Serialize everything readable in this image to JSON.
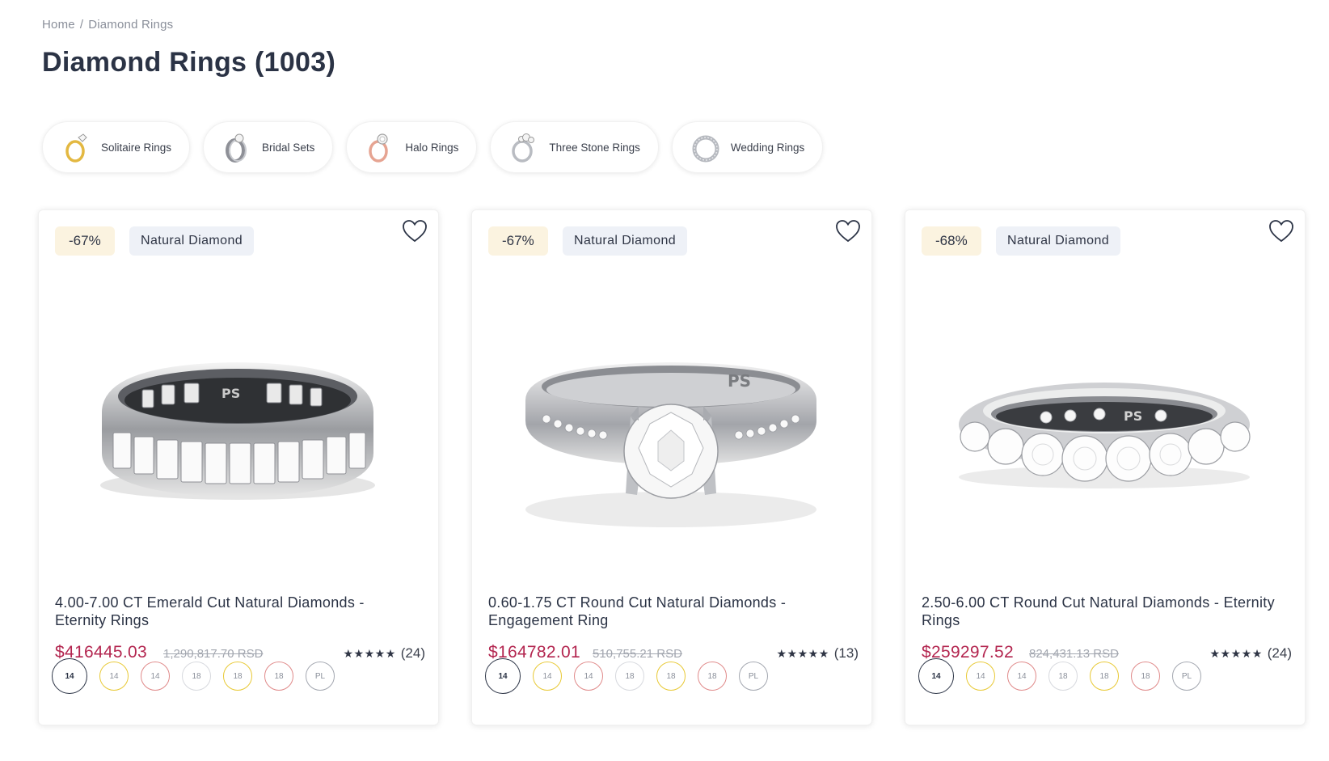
{
  "breadcrumb": {
    "home": "Home",
    "separator": "/",
    "current": "Diamond Rings"
  },
  "page_title": "Diamond Rings (1003)",
  "categories": [
    {
      "label": "Solitaire Rings",
      "icon": "solitaire-ring-icon"
    },
    {
      "label": "Bridal Sets",
      "icon": "bridal-set-icon"
    },
    {
      "label": "Halo Rings",
      "icon": "halo-ring-icon"
    },
    {
      "label": "Three Stone Rings",
      "icon": "three-stone-ring-icon"
    },
    {
      "label": "Wedding Rings",
      "icon": "wedding-ring-icon"
    }
  ],
  "products": [
    {
      "discount": "-67%",
      "type": "Natural Diamond",
      "title": "4.00-7.00 CT Emerald Cut Natural Diamonds - Eternity Rings",
      "price": "$416445.03",
      "old_price": "1,290,817.70 RSD",
      "stars": "★★★★★",
      "reviews": "(24)",
      "image": "emerald-eternity-band"
    },
    {
      "discount": "-67%",
      "type": "Natural Diamond",
      "title": "0.60-1.75 CT Round Cut Natural Diamonds - Engagement Ring",
      "price": "$164782.01",
      "old_price": "510,755.21 RSD",
      "stars": "★★★★★",
      "reviews": "(13)",
      "image": "round-solitaire-engagement-ring"
    },
    {
      "discount": "-68%",
      "type": "Natural Diamond",
      "title": "2.50-6.00 CT Round Cut Natural Diamonds - Eternity Rings",
      "price": "$259297.52",
      "old_price": "824,431.13 RSD",
      "stars": "★★★★★",
      "reviews": "(24)",
      "image": "round-eternity-band"
    }
  ],
  "metal_options": [
    {
      "label": "14",
      "tone": "white",
      "selected": true
    },
    {
      "label": "14",
      "tone": "yellow",
      "selected": false
    },
    {
      "label": "14",
      "tone": "rose",
      "selected": false
    },
    {
      "label": "18",
      "tone": "white",
      "selected": false
    },
    {
      "label": "18",
      "tone": "yellow",
      "selected": false
    },
    {
      "label": "18",
      "tone": "rose",
      "selected": false
    },
    {
      "label": "PL",
      "tone": "platinum",
      "selected": false
    }
  ],
  "colors": {
    "price": "#b3254f",
    "discount_badge_bg": "#fbf3e0",
    "type_badge_bg": "#eef1f7",
    "yellow_gold": "#e8c935",
    "rose_gold": "#e08a8a"
  }
}
